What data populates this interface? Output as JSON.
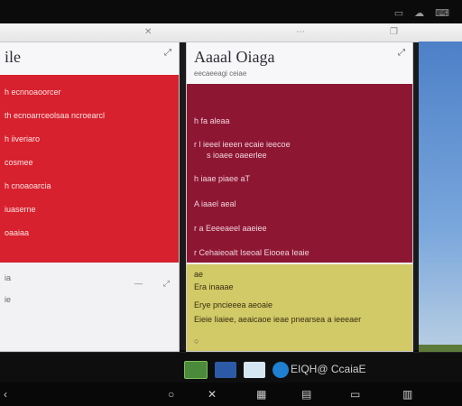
{
  "top_tray": {
    "icons": [
      "window-icon",
      "cloud-icon",
      "keyboard-icon"
    ]
  },
  "window_strip": {
    "icons": [
      "close-icon",
      "dots-icon",
      "restore-icon"
    ]
  },
  "left_panel": {
    "title": "ile",
    "header_icon": "expand-icon",
    "red_rows": [
      "h ecnnoaoorcer",
      "th ecnoarrceolsaa ncroearcl",
      "h iiveriaro",
      "cosmee",
      "h cnoaoarcia",
      "iuaserne",
      "oaaiaa"
    ],
    "white_rows": [
      "ia",
      "ie"
    ]
  },
  "mid_panel": {
    "title": "Aaaal Oiaga",
    "subtitle": "eecaeeagi ceiae",
    "header_icon": "expand-icon",
    "maroon_rows": [
      "h fa aleaa",
      "r l ieeel ieeen ecaie ieecoe",
      "s ioaee oaeerlee",
      "h iaae piaee aT",
      "A iaael aeal",
      "r a Eeeeaeel aaeiee",
      "r Cehaieoalt Iseoal Eiooea Ieaie"
    ],
    "yellow_rows": [
      "ae",
      "Era inaaae",
      "Erye pncieeea aeoaie",
      "Eieie Iiaiee, aeaicaoe ieae pnearsea a ieeeaer"
    ]
  },
  "taskbar": {
    "label": "EIQH@ CcaiaE",
    "apps": [
      "app-green",
      "app-doc",
      "app-photo",
      "app-browser"
    ]
  },
  "navbar": {
    "icons": [
      "back-icon",
      "home-icon",
      "close-icon",
      "grid-icon",
      "apps-icon",
      "screen-icon",
      "calculator-icon"
    ]
  },
  "colors": {
    "red": "#d7212e",
    "maroon": "#8d1733",
    "yellow": "#d2c967",
    "panel": "#f2f2f4",
    "sky": "#4d80c8"
  }
}
